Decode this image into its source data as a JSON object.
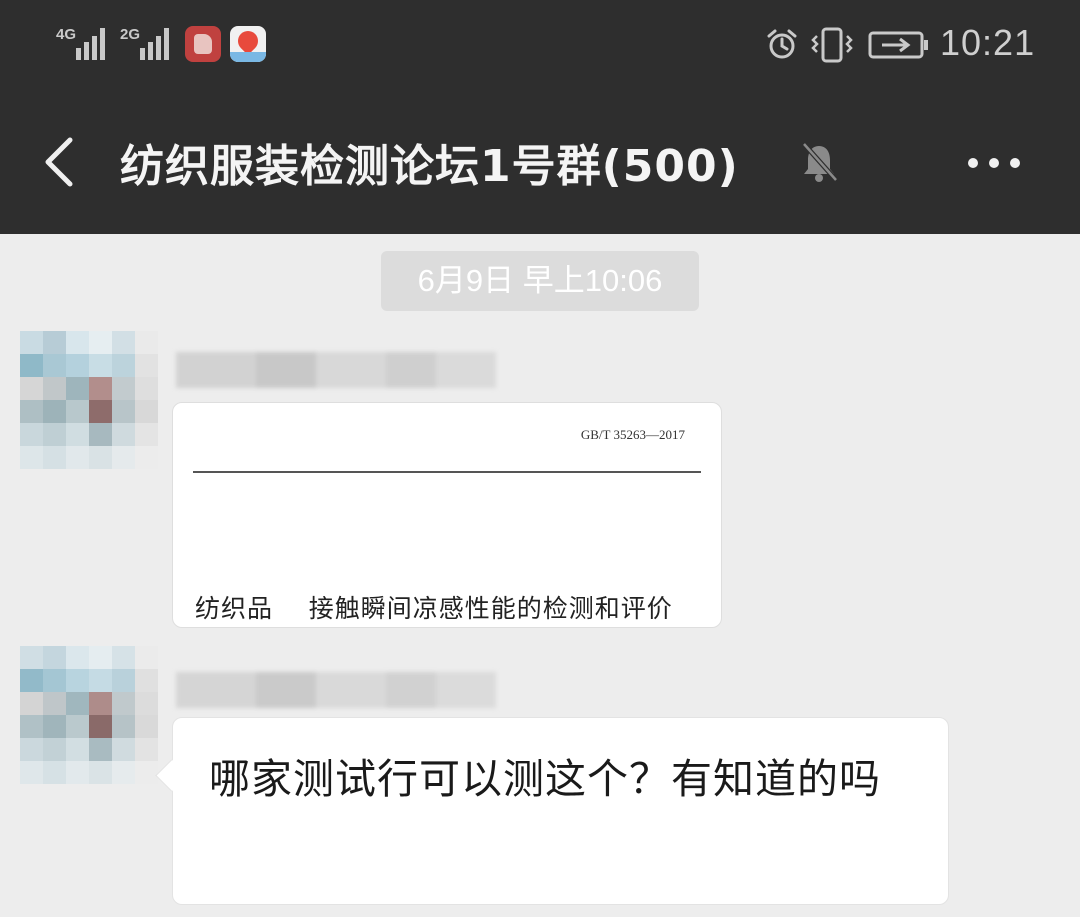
{
  "status_bar": {
    "network_1": "4G",
    "network_2": "2G",
    "time": "10:21",
    "icons": [
      "signal-4g-icon",
      "signal-2g-icon",
      "app-notification-icon",
      "map-app-icon",
      "alarm-icon",
      "vibrate-icon",
      "battery-charging-icon"
    ]
  },
  "header": {
    "title": "纺织服装检测论坛1号群(500)",
    "back_icon": "chevron-left-icon",
    "mute_icon": "bell-muted-icon",
    "more_icon": "more-dots-icon"
  },
  "chat": {
    "timestamp": "6月9日 早上10:06",
    "messages": [
      {
        "type": "document",
        "standard_code": "GB/T 35263—2017",
        "doc_title": "纺织品    接触瞬间凉感性能的检测和评价"
      },
      {
        "type": "text",
        "text": "哪家测试行可以测这个？有知道的吗"
      }
    ]
  },
  "colors": {
    "header_bg": "#2e2e2e",
    "chat_bg": "#ededed",
    "bubble_bg": "#ffffff",
    "timestamp_bg": "#dcdcdc"
  }
}
